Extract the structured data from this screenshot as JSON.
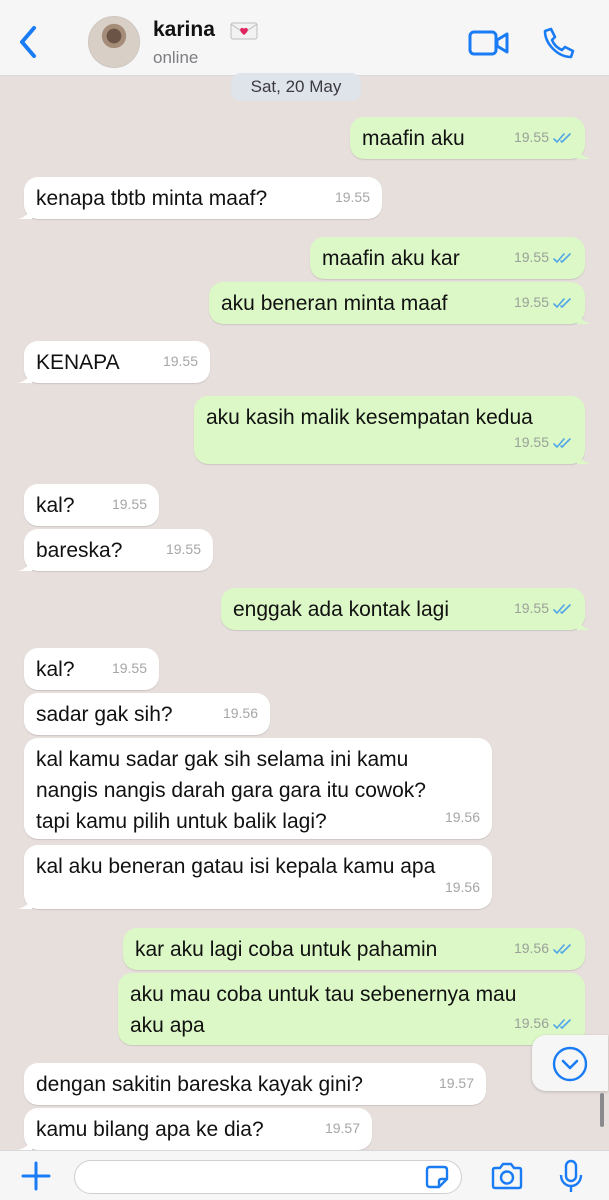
{
  "header": {
    "contact_name": "karina",
    "contact_status": "online",
    "icons": {
      "back": "chevron-left-icon",
      "video": "video-call-icon",
      "phone": "phone-call-icon",
      "emoji": "love-letter-emoji"
    }
  },
  "date_separator": "Sat, 20 May",
  "messages": [
    {
      "dir": "out",
      "text": "maafin aku",
      "time": "19.55",
      "read": true
    },
    {
      "dir": "in",
      "text": "kenapa tbtb minta maaf?",
      "time": "19.55"
    },
    {
      "dir": "out",
      "text": "maafin aku kar",
      "time": "19.55",
      "read": true
    },
    {
      "dir": "out",
      "text": "aku beneran minta maaf",
      "time": "19.55",
      "read": true
    },
    {
      "dir": "in",
      "text": "KENAPA",
      "time": "19.55"
    },
    {
      "dir": "out",
      "text": "aku kasih malik kesempatan kedua",
      "time": "19.55",
      "read": true
    },
    {
      "dir": "in",
      "text": "kal?",
      "time": "19.55"
    },
    {
      "dir": "in",
      "text": "bareska?",
      "time": "19.55"
    },
    {
      "dir": "out",
      "text": "enggak ada kontak lagi",
      "time": "19.55",
      "read": true
    },
    {
      "dir": "in",
      "text": "kal?",
      "time": "19.55"
    },
    {
      "dir": "in",
      "text": "sadar gak sih?",
      "time": "19.56"
    },
    {
      "dir": "in",
      "text": "kal kamu sadar gak sih selama ini kamu\nnangis nangis darah gara gara itu cowok?\ntapi kamu pilih untuk balik lagi?",
      "time": "19.56"
    },
    {
      "dir": "in",
      "text": "kal aku beneran gatau isi kepala kamu apa",
      "time": "19.56"
    },
    {
      "dir": "out",
      "text": "kar aku lagi coba untuk pahamin",
      "time": "19.56",
      "read": true
    },
    {
      "dir": "out",
      "text": "aku mau coba untuk tau sebenernya mau\naku apa",
      "time": "19.56",
      "read": true
    },
    {
      "dir": "in",
      "text": "dengan sakitin bareska kayak gini?",
      "time": "19.57"
    },
    {
      "dir": "in",
      "text": "kamu bilang apa ke dia?",
      "time": "19.57"
    }
  ],
  "composer": {
    "placeholder": "",
    "icons": [
      "plus-icon",
      "sticker-icon",
      "camera-icon",
      "microphone-icon"
    ]
  },
  "colors": {
    "chat_background": "#e7dfdc",
    "outgoing_bubble": "#dcf8c6",
    "incoming_bubble": "#ffffff",
    "accent": "#1a7cf5",
    "read_ticks": "#4fa6e8"
  }
}
